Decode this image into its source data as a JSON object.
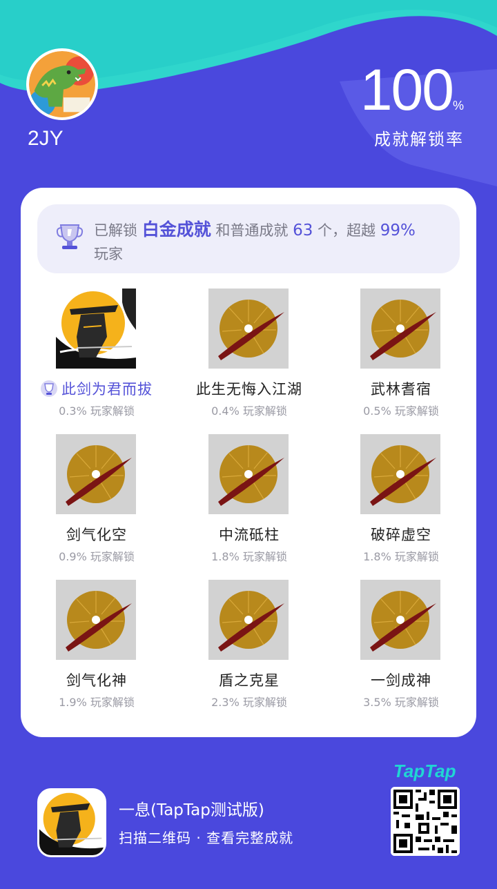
{
  "colors": {
    "background": "#4a48dd",
    "accent": "#5452d8",
    "teal": "#20d6d3",
    "card": "#ffffff",
    "summary_bg": "#eeeefa"
  },
  "user": {
    "name": "2JY",
    "avatar_icon": "dinosaur-avatar"
  },
  "rate": {
    "value": "100",
    "unit": "%",
    "label": "成就解锁率"
  },
  "summary": {
    "icon": "trophy-icon",
    "prefix": "已解锁",
    "highlight": "白金成就",
    "mid": "和普通成就",
    "count": "63",
    "count_suffix": "个，超越",
    "percent": "99%",
    "suffix": "玩家"
  },
  "achievements": [
    {
      "name": "此剑为君而拔",
      "percent": "0.3% 玩家解锁",
      "platinum": true,
      "icon": "swordsman-icon"
    },
    {
      "name": "此生无悔入江湖",
      "percent": "0.4% 玩家解锁",
      "platinum": false,
      "icon": "slashed-disc-icon"
    },
    {
      "name": "武林耆宿",
      "percent": "0.5% 玩家解锁",
      "platinum": false,
      "icon": "slashed-disc-icon"
    },
    {
      "name": "剑气化空",
      "percent": "0.9% 玩家解锁",
      "platinum": false,
      "icon": "slashed-disc-icon"
    },
    {
      "name": "中流砥柱",
      "percent": "1.8% 玩家解锁",
      "platinum": false,
      "icon": "slashed-disc-icon"
    },
    {
      "name": "破碎虚空",
      "percent": "1.8% 玩家解锁",
      "platinum": false,
      "icon": "slashed-disc-icon"
    },
    {
      "name": "剑气化神",
      "percent": "1.9% 玩家解锁",
      "platinum": false,
      "icon": "slashed-disc-icon"
    },
    {
      "name": "盾之克星",
      "percent": "2.3% 玩家解锁",
      "platinum": false,
      "icon": "slashed-disc-icon"
    },
    {
      "name": "一剑成神",
      "percent": "3.5% 玩家解锁",
      "platinum": false,
      "icon": "slashed-disc-icon"
    }
  ],
  "footer": {
    "game_title": "一息(TapTap测试版)",
    "subtitle": "扫描二维码 · 查看完整成就",
    "brand": "TapTap",
    "qr_icon": "qr-code"
  }
}
